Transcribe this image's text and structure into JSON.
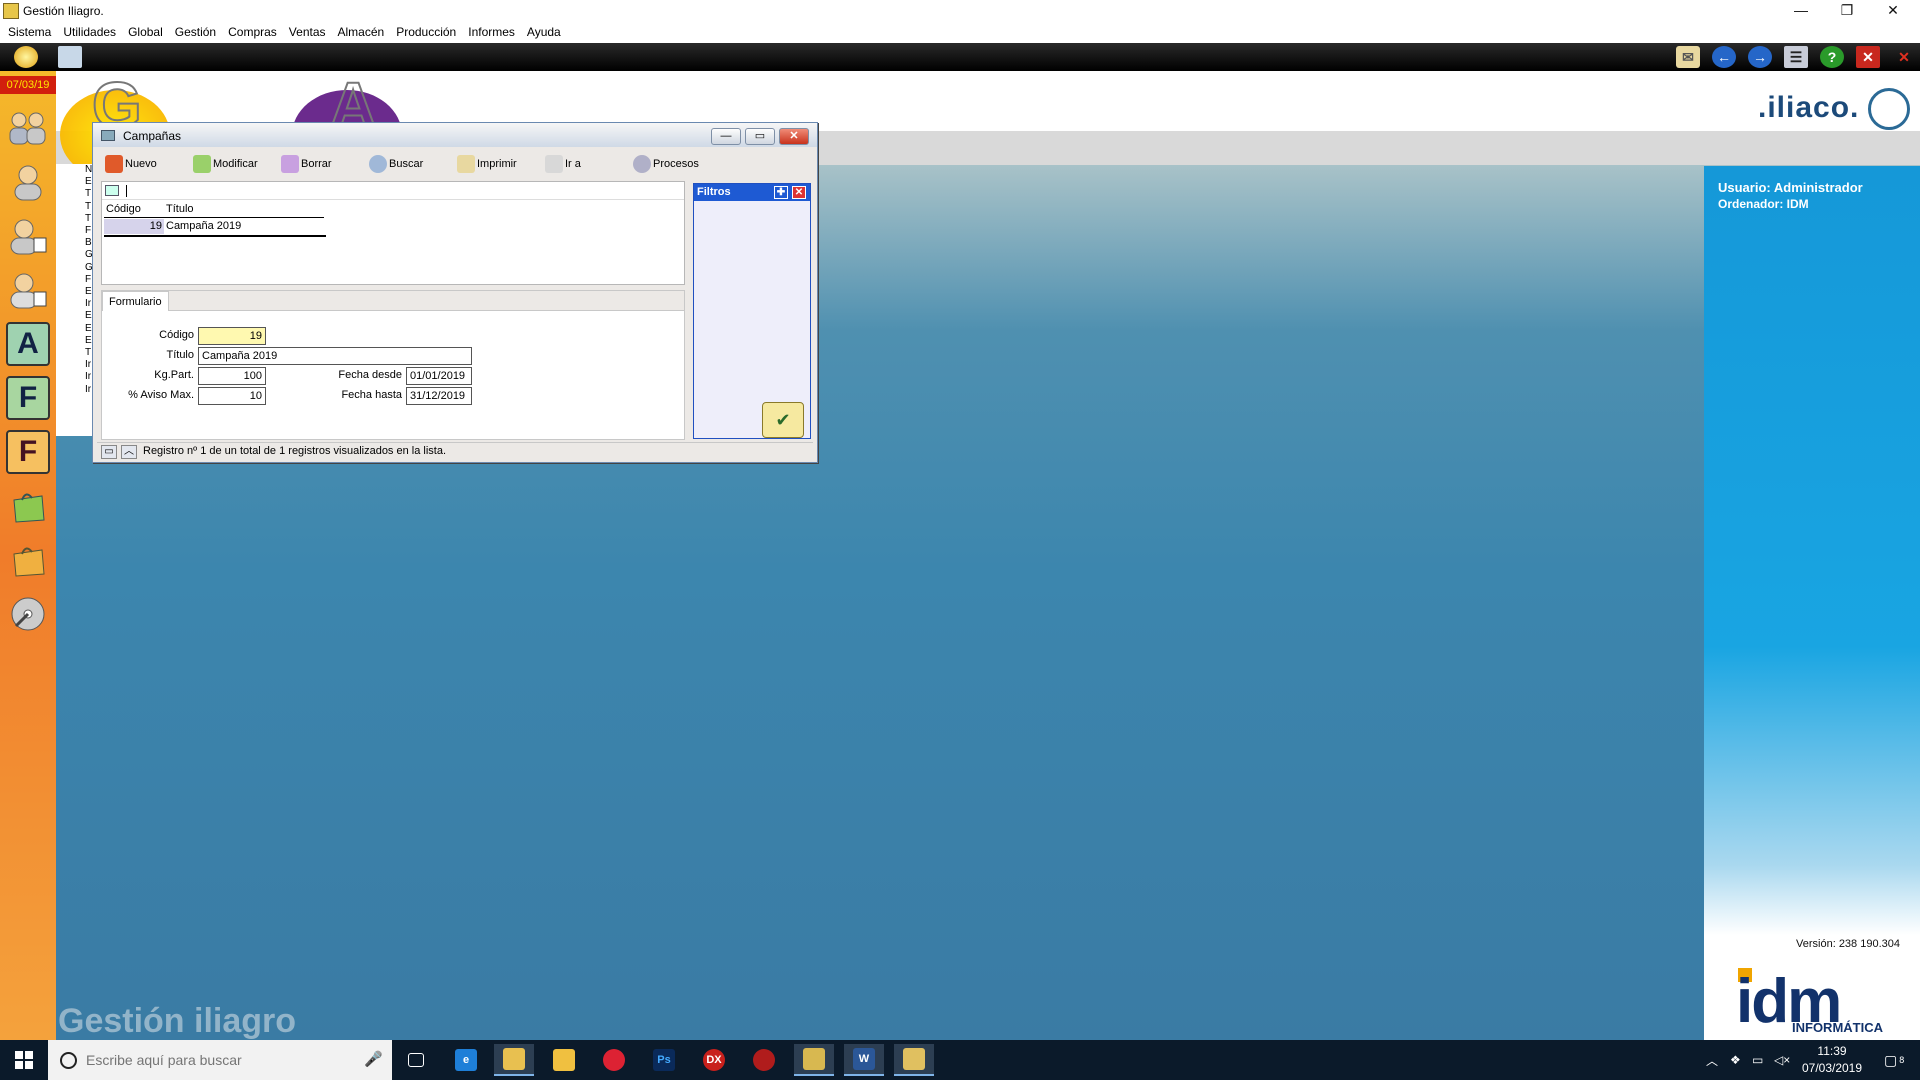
{
  "window": {
    "title": "Gestión Iliagro.",
    "controls": [
      "—",
      "❐",
      "✕"
    ]
  },
  "menu": [
    "Sistema",
    "Utilidades",
    "Global",
    "Gestión",
    "Compras",
    "Ventas",
    "Almacén",
    "Producción",
    "Informes",
    "Ayuda"
  ],
  "launcher": {
    "date": "07/03/19",
    "letters": {
      "a": "A",
      "f1": "F",
      "f2": "F"
    }
  },
  "desktop": {
    "logo": ".iliaco.",
    "deco_g": "G",
    "deco_a": "A",
    "watermark": "Gestión iliagro",
    "strip_letters": [
      "N",
      "E",
      "T",
      "T",
      "T",
      "F",
      "B",
      "G",
      "G",
      "F",
      "E",
      "Ir",
      "E",
      "E",
      "E",
      "T",
      "Ir",
      "Ir",
      "Ir"
    ]
  },
  "info": {
    "user": "Usuario: Administrador",
    "computer": "Ordenador:  IDM",
    "version": "Versión: 238 190.304",
    "brand": "idm",
    "brand_sub": "INFORMÁTICA"
  },
  "campaigns_window": {
    "title": "Campañas",
    "toolbar": [
      {
        "label": "Nuevo",
        "color": "#e05a2a"
      },
      {
        "label": "Modificar",
        "color": "#9ad06a"
      },
      {
        "label": "Borrar",
        "color": "#c8a0e0"
      },
      {
        "label": "Buscar",
        "color": "#a0b8d8"
      },
      {
        "label": "Imprimir",
        "color": "#e8d8a0"
      },
      {
        "label": "Ir a",
        "color": "#d8d8d8"
      },
      {
        "label": "Procesos",
        "color": "#b0b0c8"
      }
    ],
    "grid": {
      "headers": [
        "Código",
        "Título"
      ],
      "rows": [
        {
          "code": "19",
          "title": "Campaña 2019"
        }
      ]
    },
    "tab": "Formulario",
    "form": {
      "codigo_label": "Código",
      "codigo_value": "19",
      "titulo_label": "Título",
      "titulo_value": "Campaña 2019",
      "kg_label": "Kg.Part.",
      "kg_value": "100",
      "aviso_label": "% Aviso Max.",
      "aviso_value": "10",
      "desde_label": "Fecha desde",
      "desde_value": "01/01/2019",
      "hasta_label": "Fecha hasta",
      "hasta_value": "31/12/2019"
    },
    "filters": {
      "title": "Filtros"
    },
    "status": "Registro nº 1 de un total de 1 registros visualizados en la lista."
  },
  "taskbar": {
    "search_placeholder": "Escribe aquí para buscar",
    "time": "11:39",
    "date": "07/03/2019",
    "notifications": "8"
  },
  "colors": {
    "accent_blue": "#1e5ad3",
    "launcher_orange": "#f07c2a",
    "date_red": "#d21f0d",
    "desktop_blue": "#3c86ae",
    "info_blue": "#1598d8"
  }
}
